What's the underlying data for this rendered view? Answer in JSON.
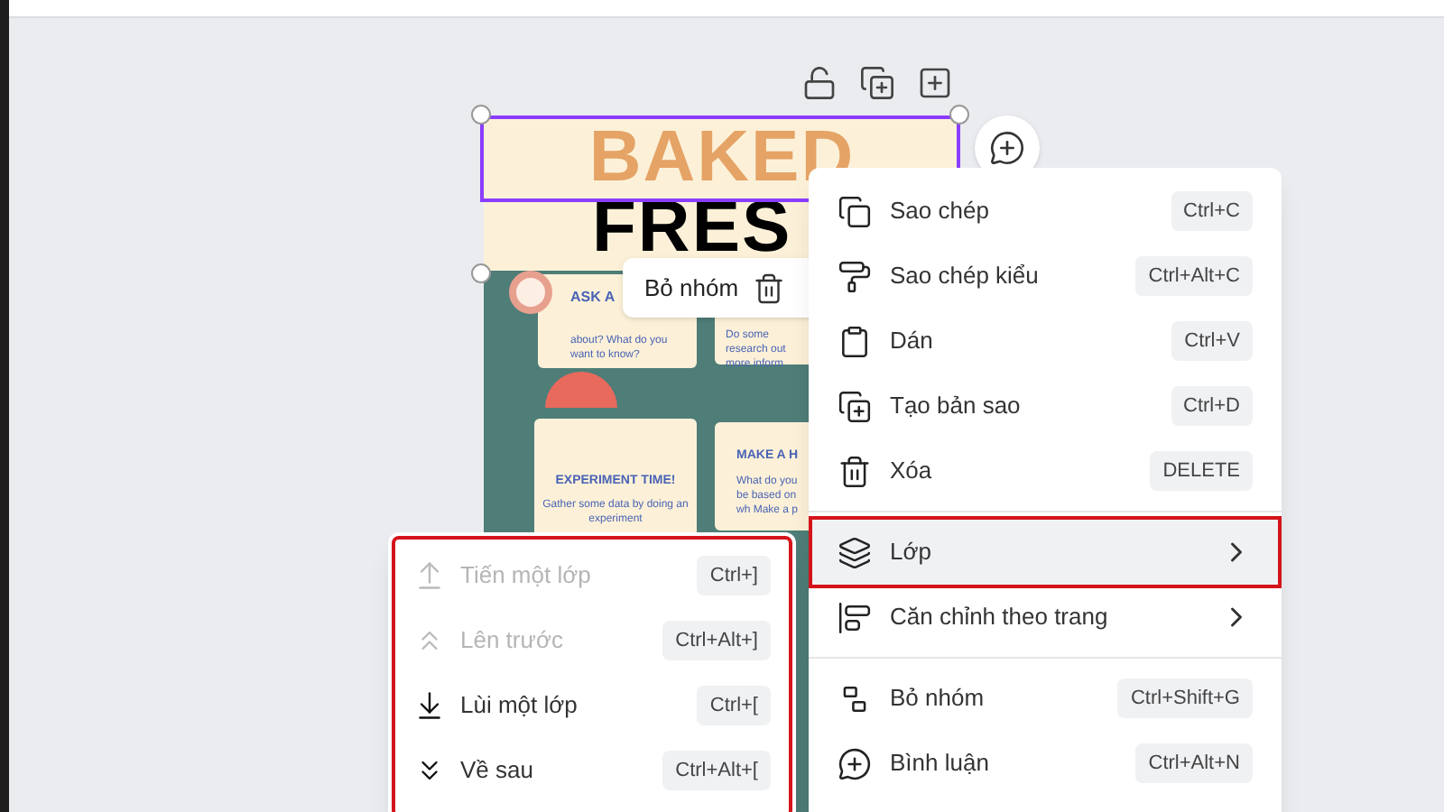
{
  "poster": {
    "title_line_1": "BAKED",
    "title_line_2": "FRES",
    "cards": [
      {
        "heading": "ASK A",
        "body": "about? What do you want to know?"
      },
      {
        "body": "Do some research out more inform"
      },
      {
        "heading": "EXPERIMENT TIME!",
        "body": "Gather some data by doing an experiment"
      },
      {
        "heading": "MAKE A H",
        "body": "What do you be based on wh Make a p"
      }
    ]
  },
  "selection_toolbar": {
    "label": "Bỏ nhóm"
  },
  "context_menu": {
    "sections": [
      [
        {
          "label": "Sao chép",
          "shortcut": "Ctrl+C",
          "kind": "item",
          "highlighted": false
        },
        {
          "label": "Sao chép kiểu",
          "shortcut": "Ctrl+Alt+C",
          "kind": "item",
          "highlighted": false
        },
        {
          "label": "Dán",
          "shortcut": "Ctrl+V",
          "kind": "item",
          "highlighted": false
        },
        {
          "label": "Tạo bản sao",
          "shortcut": "Ctrl+D",
          "kind": "item",
          "highlighted": false
        },
        {
          "label": "Xóa",
          "shortcut": "DELETE",
          "kind": "item",
          "highlighted": false
        }
      ],
      [
        {
          "label": "Lớp",
          "kind": "submenu",
          "highlighted": true
        },
        {
          "label": "Căn chỉnh theo trang",
          "kind": "submenu",
          "highlighted": false
        }
      ],
      [
        {
          "label": "Bỏ nhóm",
          "shortcut": "Ctrl+Shift+G",
          "kind": "item",
          "highlighted": false
        },
        {
          "label": "Bình luận",
          "shortcut": "Ctrl+Alt+N",
          "kind": "item",
          "highlighted": false
        }
      ]
    ]
  },
  "layer_submenu": {
    "highlighted": true,
    "items": [
      {
        "label": "Tiến một lớp",
        "shortcut": "Ctrl+]",
        "disabled": true
      },
      {
        "label": "Lên trước",
        "shortcut": "Ctrl+Alt+]",
        "disabled": true
      },
      {
        "label": "Lùi một lớp",
        "shortcut": "Ctrl+[",
        "disabled": false
      },
      {
        "label": "Về sau",
        "shortcut": "Ctrl+Alt+[",
        "disabled": false
      }
    ]
  }
}
